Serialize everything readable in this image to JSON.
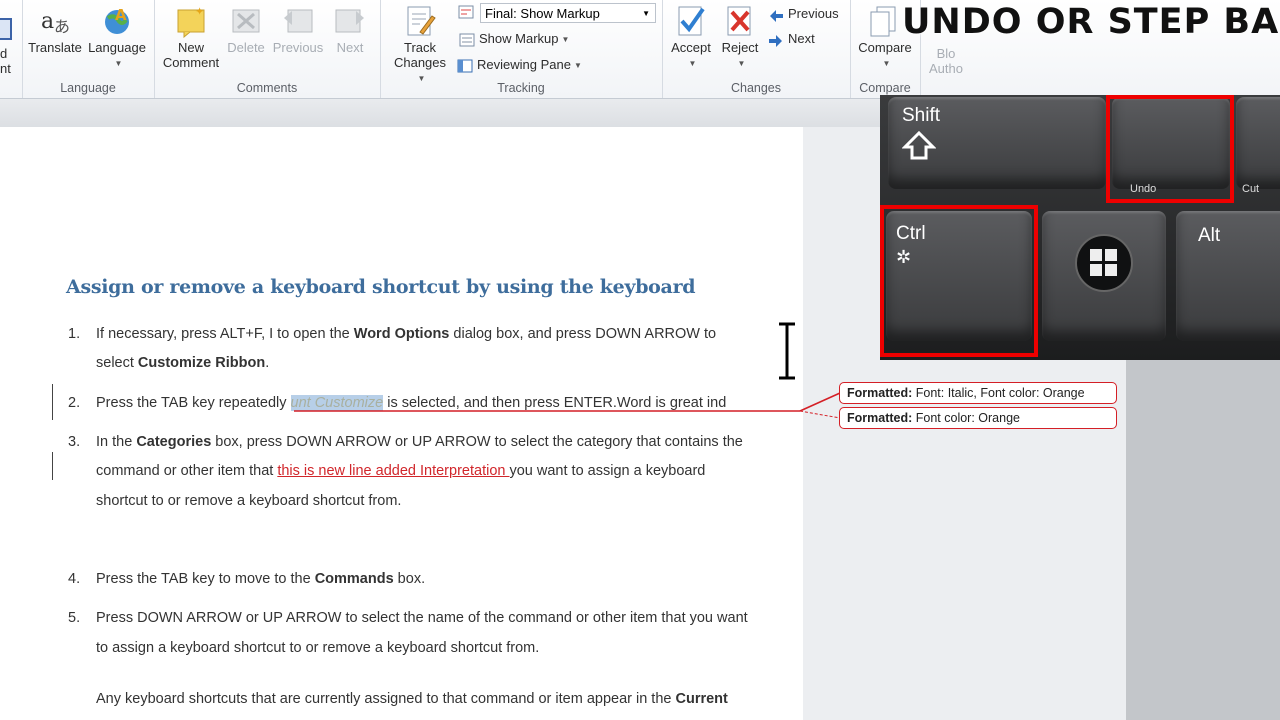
{
  "ribbon": {
    "left_cut": {
      "line1": "d",
      "line2": "nt"
    },
    "language_group": {
      "label": "Language",
      "translate": "Translate",
      "language": "Language"
    },
    "comments_group": {
      "label": "Comments",
      "new_comment_l1": "New",
      "new_comment_l2": "Comment",
      "delete": "Delete",
      "previous": "Previous",
      "next": "Next"
    },
    "tracking_group": {
      "label": "Tracking",
      "track_changes_l1": "Track",
      "track_changes_l2": "Changes",
      "display_select": "Final: Show Markup",
      "show_markup": "Show Markup",
      "reviewing_pane": "Reviewing Pane"
    },
    "changes_group": {
      "label": "Changes",
      "accept": "Accept",
      "reject": "Reject",
      "previous": "Previous",
      "next": "Next"
    },
    "compare_group": {
      "label": "Compare",
      "compare": "Compare",
      "block_l1": "Blo",
      "block_l2": "Autho"
    }
  },
  "overlay": {
    "title": "UNDO OR STEP BACK"
  },
  "keyboard": {
    "shift": "Shift",
    "ctrl": "Ctrl",
    "alt": "Alt",
    "undo": "Undo",
    "cut": "Cut"
  },
  "document": {
    "heading": "Assign or remove a keyboard shortcut by using the keyboard",
    "items": [
      {
        "num": "1.",
        "line1_a": "If necessary, press ALT+F, I to open the ",
        "line1_b": "Word Options",
        "line1_c": " dialog box, and press DOWN ARROW to",
        "line2_a": "select ",
        "line2_b": "Customize Ribbon",
        "line2_c": "."
      },
      {
        "num": "2.",
        "line1_a": "Press the TAB key repeatedly ",
        "line1_sel": "unt Customize",
        "line1_c": " is selected, and then press ENTER.Word is great ind"
      },
      {
        "num": "3.",
        "line1_a": "In the ",
        "line1_b": "Categories",
        "line1_c": " box, press DOWN ARROW or UP ARROW to select the category that contains the",
        "line2_a": "command or other item that ",
        "line2_ins": "this is new line added Interpretation ",
        "line2_c": "you want to assign a keyboard",
        "line3": "shortcut to or remove a keyboard shortcut from."
      },
      {
        "num": "4.",
        "line1_a": "Press the TAB key to move to the ",
        "line1_b": "Commands",
        "line1_c": " box."
      },
      {
        "num": "5.",
        "line1": "Press DOWN ARROW or UP ARROW to select the name of the command or other item that you want",
        "line2": "to assign a keyboard shortcut to or remove a keyboard shortcut from."
      }
    ],
    "note_a": "Any keyboard shortcuts that are currently assigned to that command or item appear in the ",
    "note_b": "Current"
  },
  "balloons": [
    {
      "label": "Formatted:",
      "text": " Font: Italic, Font color: Orange"
    },
    {
      "label": "Formatted:",
      "text": " Font color: Orange"
    }
  ],
  "colors": {
    "heading": "#3e6d9c",
    "insert": "#d1262b",
    "highlight": "#e00000"
  }
}
